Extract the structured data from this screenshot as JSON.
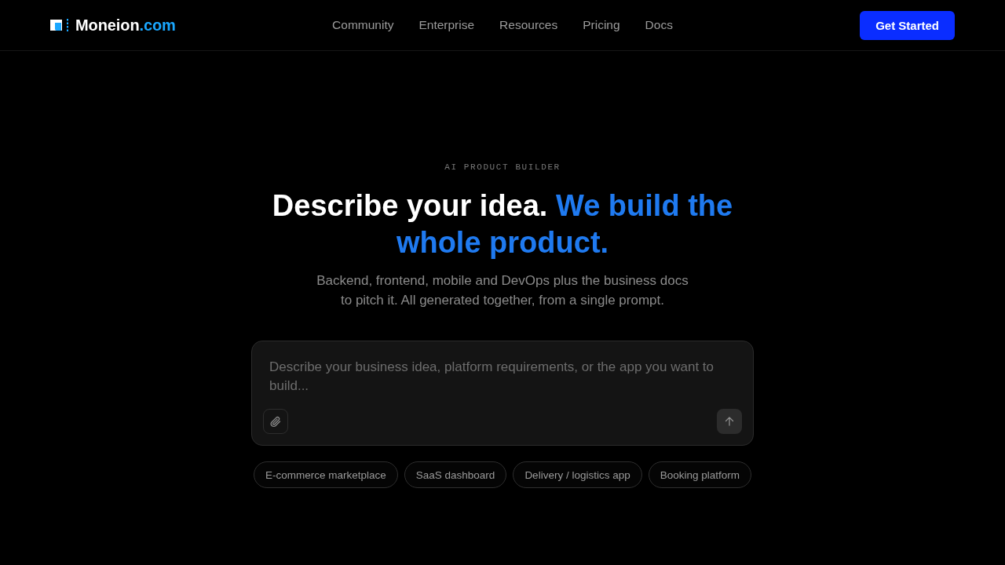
{
  "header": {
    "logo": {
      "name": "Moneion",
      "suffix": ".com"
    },
    "nav": [
      "Community",
      "Enterprise",
      "Resources",
      "Pricing",
      "Docs"
    ],
    "cta": "Get Started"
  },
  "hero": {
    "eyebrow": "AI PRODUCT BUILDER",
    "heading": {
      "lead": "Describe your idea.",
      "accent": "We build the whole product."
    },
    "subtitle": "Backend, frontend, mobile and DevOps plus the business docs to pitch it. All generated together, from a single prompt."
  },
  "composer": {
    "placeholder": "Describe your business idea, platform requirements, or the app you want to build..."
  },
  "suggestions": [
    "E-commerce marketplace",
    "SaaS dashboard",
    "Delivery / logistics app",
    "Booking platform"
  ]
}
